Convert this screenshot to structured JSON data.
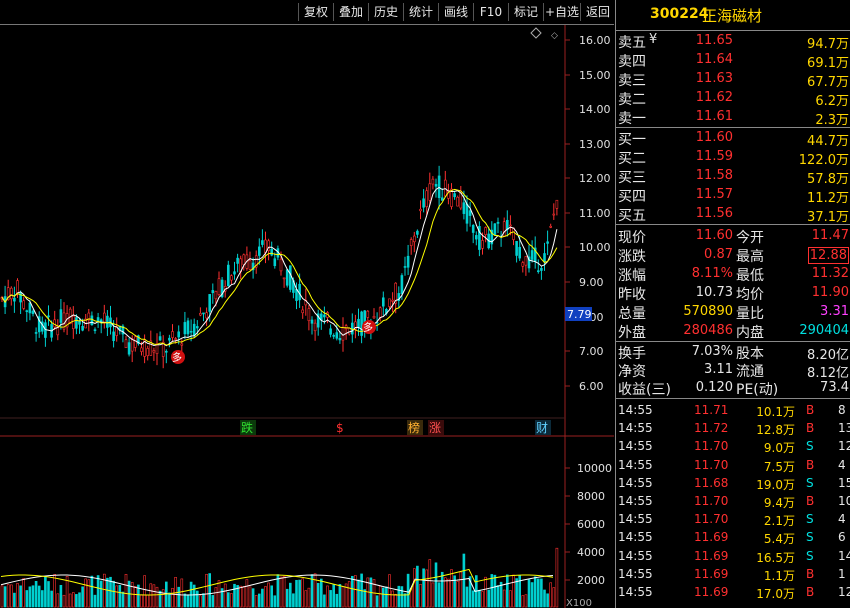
{
  "toolbar": [
    "复权",
    "叠加",
    "历史",
    "统计",
    "画线",
    "F10",
    "标记",
    "+自选",
    "返回"
  ],
  "stock": {
    "code": "300224",
    "name": "正海磁材"
  },
  "chart": {
    "price_ticks": [
      "16.00",
      "15.00",
      "14.00",
      "13.00",
      "12.00",
      "11.00",
      "10.00",
      "9.00",
      "8.00",
      "7.00",
      "6.00"
    ],
    "current_marker": "7.79",
    "volume_ticks": [
      "10000",
      "8000",
      "6000",
      "4000",
      "2000"
    ],
    "volume_unit": "X100",
    "event_labels": [
      "跌",
      "$",
      "榜",
      "涨",
      "财"
    ],
    "signal_label": "多"
  },
  "order_book": {
    "asks": [
      {
        "label": "卖五",
        "price": "11.65",
        "vol": "94.7万",
        "mark": "¥"
      },
      {
        "label": "卖四",
        "price": "11.64",
        "vol": "69.1万"
      },
      {
        "label": "卖三",
        "price": "11.63",
        "vol": "67.7万"
      },
      {
        "label": "卖二",
        "price": "11.62",
        "vol": "6.2万"
      },
      {
        "label": "卖一",
        "price": "11.61",
        "vol": "2.3万"
      }
    ],
    "bids": [
      {
        "label": "买一",
        "price": "11.60",
        "vol": "44.7万"
      },
      {
        "label": "买二",
        "price": "11.59",
        "vol": "122.0万"
      },
      {
        "label": "买三",
        "price": "11.58",
        "vol": "57.8万"
      },
      {
        "label": "买四",
        "price": "11.57",
        "vol": "11.2万"
      },
      {
        "label": "买五",
        "price": "11.56",
        "vol": "37.1万"
      }
    ]
  },
  "stats": [
    {
      "l1": "现价",
      "v1": "11.60",
      "l2": "今开",
      "v2": "11.47"
    },
    {
      "l1": "涨跌",
      "v1": "0.87",
      "l2": "最高",
      "v2": "12.88"
    },
    {
      "l1": "涨幅",
      "v1": "8.11%",
      "l2": "最低",
      "v2": "11.32"
    },
    {
      "l1": "昨收",
      "v1": "10.73",
      "l2": "均价",
      "v2": "11.90"
    },
    {
      "l1": "总量",
      "v1": "570890",
      "l2": "量比",
      "v2": "3.31"
    },
    {
      "l1": "外盘",
      "v1": "280486",
      "l2": "内盘",
      "v2": "290404"
    }
  ],
  "stats2": [
    {
      "l1": "换手",
      "v1": "7.03%",
      "l2": "股本",
      "v2": "8.20亿"
    },
    {
      "l1": "净资",
      "v1": "3.11",
      "l2": "流通",
      "v2": "8.12亿"
    },
    {
      "l1": "收益(三)",
      "v1": "0.120",
      "l2": "PE(动)",
      "v2": "73.4"
    }
  ],
  "ticks": [
    {
      "t": "14:55",
      "p": "11.71",
      "v": "10.1万",
      "s": "B",
      "n": "8"
    },
    {
      "t": "14:55",
      "p": "11.72",
      "v": "12.8万",
      "s": "B",
      "n": "13"
    },
    {
      "t": "14:55",
      "p": "11.70",
      "v": "9.0万",
      "s": "S",
      "n": "12"
    },
    {
      "t": "14:55",
      "p": "11.70",
      "v": "7.5万",
      "s": "B",
      "n": "4"
    },
    {
      "t": "14:55",
      "p": "11.68",
      "v": "19.0万",
      "s": "S",
      "n": "15"
    },
    {
      "t": "14:55",
      "p": "11.70",
      "v": "9.4万",
      "s": "B",
      "n": "10"
    },
    {
      "t": "14:55",
      "p": "11.70",
      "v": "2.1万",
      "s": "S",
      "n": "4"
    },
    {
      "t": "14:55",
      "p": "11.69",
      "v": "5.4万",
      "s": "S",
      "n": "6"
    },
    {
      "t": "14:55",
      "p": "11.69",
      "v": "16.5万",
      "s": "S",
      "n": "14"
    },
    {
      "t": "14:55",
      "p": "11.69",
      "v": "1.1万",
      "s": "B",
      "n": "1"
    },
    {
      "t": "14:55",
      "p": "11.69",
      "v": "17.0万",
      "s": "B",
      "n": "12"
    }
  ]
}
